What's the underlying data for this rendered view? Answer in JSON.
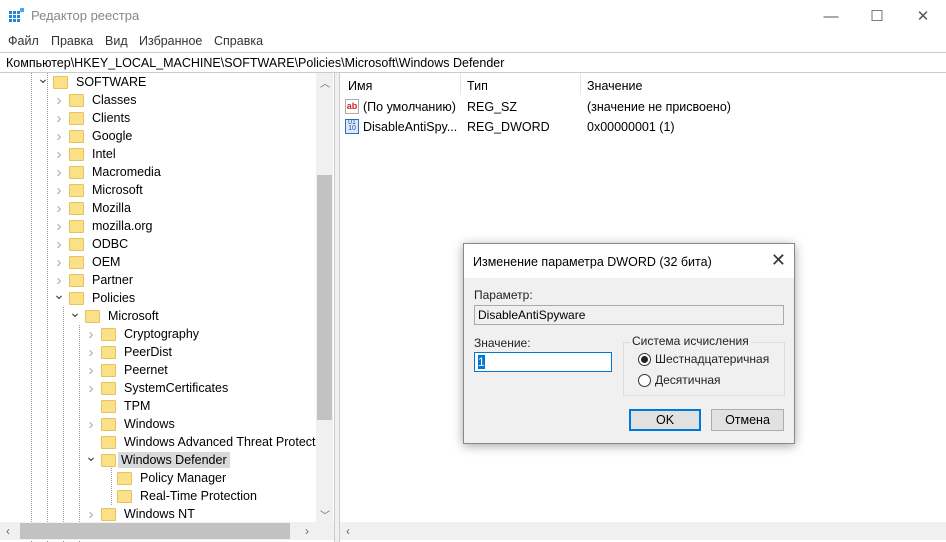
{
  "window": {
    "title": "Редактор реестра",
    "minimize": "—",
    "maximize": "☐",
    "close": "✕"
  },
  "menu": [
    "Файл",
    "Правка",
    "Вид",
    "Избранное",
    "Справка"
  ],
  "address": "Компьютер\\HKEY_LOCAL_MACHINE\\SOFTWARE\\Policies\\Microsoft\\Windows Defender",
  "tree": [
    {
      "label": "SOFTWARE",
      "level": 0,
      "state": "expanded"
    },
    {
      "label": "Classes",
      "level": 1,
      "state": "collapsed"
    },
    {
      "label": "Clients",
      "level": 1,
      "state": "collapsed"
    },
    {
      "label": "Google",
      "level": 1,
      "state": "collapsed"
    },
    {
      "label": "Intel",
      "level": 1,
      "state": "collapsed"
    },
    {
      "label": "Macromedia",
      "level": 1,
      "state": "collapsed"
    },
    {
      "label": "Microsoft",
      "level": 1,
      "state": "collapsed"
    },
    {
      "label": "Mozilla",
      "level": 1,
      "state": "collapsed"
    },
    {
      "label": "mozilla.org",
      "level": 1,
      "state": "collapsed"
    },
    {
      "label": "ODBC",
      "level": 1,
      "state": "collapsed"
    },
    {
      "label": "OEM",
      "level": 1,
      "state": "collapsed"
    },
    {
      "label": "Partner",
      "level": 1,
      "state": "collapsed"
    },
    {
      "label": "Policies",
      "level": 1,
      "state": "expanded"
    },
    {
      "label": "Microsoft",
      "level": 2,
      "state": "expanded"
    },
    {
      "label": "Cryptography",
      "level": 3,
      "state": "collapsed"
    },
    {
      "label": "PeerDist",
      "level": 3,
      "state": "collapsed"
    },
    {
      "label": "Peernet",
      "level": 3,
      "state": "collapsed"
    },
    {
      "label": "SystemCertificates",
      "level": 3,
      "state": "collapsed"
    },
    {
      "label": "TPM",
      "level": 3,
      "state": "leaf"
    },
    {
      "label": "Windows",
      "level": 3,
      "state": "collapsed"
    },
    {
      "label": "Windows Advanced Threat Protection",
      "level": 3,
      "state": "leaf"
    },
    {
      "label": "Windows Defender",
      "level": 3,
      "state": "expanded",
      "selected": true
    },
    {
      "label": "Policy Manager",
      "level": 4,
      "state": "leaf"
    },
    {
      "label": "Real-Time Protection",
      "level": 4,
      "state": "leaf"
    },
    {
      "label": "Windows NT",
      "level": 3,
      "state": "collapsed"
    }
  ],
  "list": {
    "columns": [
      "Имя",
      "Тип",
      "Значение"
    ],
    "rows": [
      {
        "icon": "string-value-icon",
        "name": "(По умолчанию)",
        "type": "REG_SZ",
        "value": "(значение не присвоено)"
      },
      {
        "icon": "dword-value-icon",
        "name": "DisableAntiSpy...",
        "type": "REG_DWORD",
        "value": "0x00000001 (1)"
      }
    ]
  },
  "dialog": {
    "title": "Изменение параметра DWORD (32 бита)",
    "close": "✕",
    "param_label": "Параметр:",
    "param_value": "DisableAntiSpyware",
    "value_label": "Значение:",
    "value": "1",
    "base_label": "Система исчисления",
    "hex_label": "Шестнадцатеричная",
    "dec_label": "Десятичная",
    "base_selected": "hex",
    "ok": "OK",
    "cancel": "Отмена"
  }
}
